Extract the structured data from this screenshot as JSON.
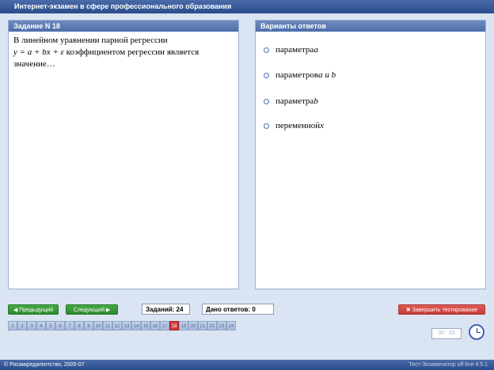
{
  "window": {
    "title": "Интернет-экзамен в сфере профессионального образования"
  },
  "question_panel": {
    "header": "Задание N 18",
    "line1": "В линейном  уравнении парной регрессии",
    "formula": "y = a + bx + ε",
    "line2_rest": " коэффициентом регрессии является",
    "line3": "значение…"
  },
  "answers_panel": {
    "header": "Варианты ответов",
    "options": [
      {
        "text": "параметра ",
        "var": "a"
      },
      {
        "text": "параметров ",
        "var": "a и b"
      },
      {
        "text": "параметра ",
        "var": "b"
      },
      {
        "text": "переменной ",
        "var": "x"
      }
    ]
  },
  "controls": {
    "prev_label": "◀ Предыдущий",
    "next_label": "Следующий ▶",
    "tasks_label": "Заданий: 24",
    "answered_label": "Дано ответов: 0",
    "finish_label": "✖ Завершить тестирование"
  },
  "tasks": [
    "1",
    "2",
    "3",
    "4",
    "5",
    "6",
    "7",
    "8",
    "9",
    "10",
    "11",
    "12",
    "13",
    "14",
    "15",
    "16",
    "17",
    "18",
    "19",
    "20",
    "21",
    "22",
    "23",
    "24"
  ],
  "current_task": "18",
  "timer": "30 : 33",
  "status": {
    "left": "© Росаккредагентство, 2005-07",
    "right": "Тест-Экзаменатор off-line 4.5.1"
  }
}
